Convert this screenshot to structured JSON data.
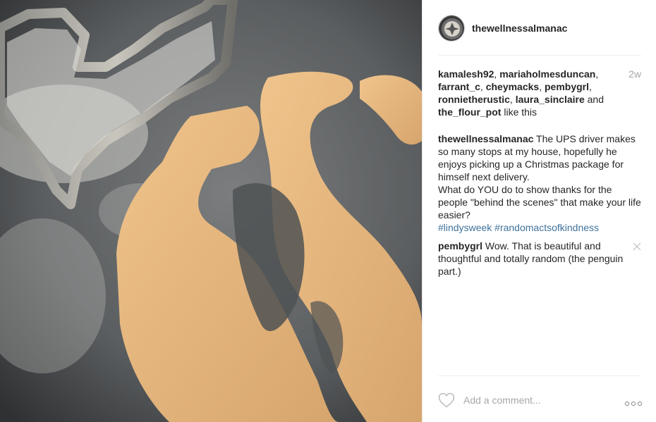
{
  "post": {
    "author": "thewellnessalmanac",
    "age": "2w",
    "likes": {
      "users": [
        {
          "name": "kamalesh92",
          "sep": ", "
        },
        {
          "name": "mariaholmesduncan",
          "sep": ", "
        },
        {
          "name": "farrant_c",
          "sep": ", "
        },
        {
          "name": "cheymacks",
          "sep": ", "
        },
        {
          "name": "pembygrl",
          "sep": ", "
        },
        {
          "name": "ronnietherustic",
          "sep": ", "
        },
        {
          "name": "laura_sinclaire",
          "sep": " and "
        },
        {
          "name": "the_flour_pot",
          "sep": ""
        }
      ],
      "suffix": " like this"
    },
    "caption": {
      "author": "thewellnessalmanac",
      "text1": " The UPS driver makes so many stops at my house, hopefully he enjoys picking up a Christmas package for himself next delivery.",
      "text2": "What do YOU do to show thanks for the people \"behind the scenes\" that make your life easier?",
      "hashtags": [
        "#lindysweek",
        "#randomactsofkindness"
      ]
    },
    "comments": [
      {
        "author": "pembygrl",
        "text": " Wow. That is beautiful and thoughtful and totally random (the penguin part.)"
      }
    ]
  },
  "footer": {
    "comment_placeholder": "Add a comment..."
  },
  "icons": {
    "like": "heart-outline-icon",
    "more": "more-options-icon",
    "delete": "close-icon"
  },
  "colors": {
    "link": "#3f729b",
    "muted": "#a5a7aa",
    "text": "#262626"
  }
}
